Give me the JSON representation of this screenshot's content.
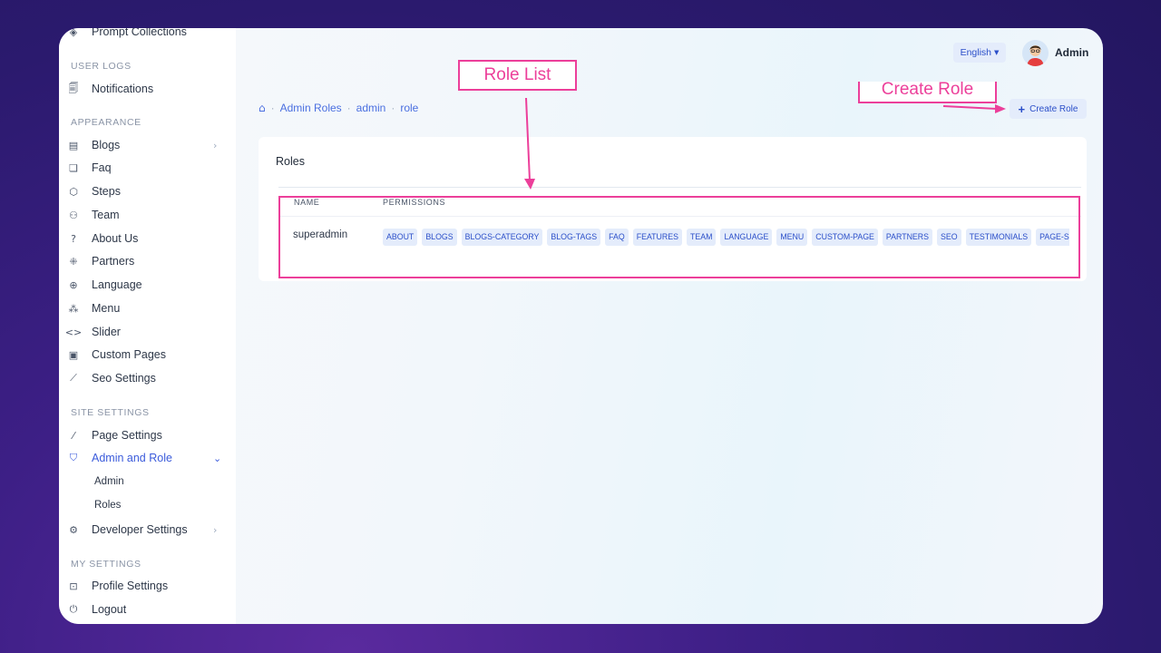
{
  "sidebar": {
    "top_item": "Prompt Collections",
    "sections": [
      {
        "title": "USER LOGS"
      },
      {
        "title": "APPEARANCE"
      },
      {
        "title": "SITE SETTINGS"
      },
      {
        "title": "MY SETTINGS"
      }
    ],
    "items": [
      {
        "label": "Notifications",
        "icon": "bell-icon"
      },
      {
        "label": "Blogs",
        "icon": "blog-icon"
      },
      {
        "label": "Faq",
        "icon": "faq-icon"
      },
      {
        "label": "Steps",
        "icon": "steps-icon"
      },
      {
        "label": "Team",
        "icon": "team-icon"
      },
      {
        "label": "About Us",
        "icon": "help-icon"
      },
      {
        "label": "Partners",
        "icon": "partners-icon"
      },
      {
        "label": "Language",
        "icon": "globe-icon"
      },
      {
        "label": "Menu",
        "icon": "menu-icon"
      },
      {
        "label": "Slider",
        "icon": "code-icon"
      },
      {
        "label": "Custom Pages",
        "icon": "page-icon"
      },
      {
        "label": "Seo Settings",
        "icon": "chart-icon"
      },
      {
        "label": "Page Settings",
        "icon": "magic-wand-icon"
      },
      {
        "label": "Admin and Role",
        "icon": "shield-icon"
      },
      {
        "label": "Developer Settings",
        "icon": "gear-icon"
      },
      {
        "label": "Profile Settings",
        "icon": "profile-icon"
      },
      {
        "label": "Logout",
        "icon": "power-icon"
      }
    ],
    "sub_items": [
      "Admin",
      "Roles"
    ]
  },
  "header": {
    "language": "English",
    "user_name": "Admin"
  },
  "breadcrumb": [
    "Admin Roles",
    "admin",
    "role"
  ],
  "create_button": "Create Role",
  "card": {
    "title": "Roles",
    "columns": [
      "NAME",
      "PERMISSIONS"
    ],
    "rows": [
      {
        "name": "superadmin",
        "permissions": [
          "ABOUT",
          "BLOGS",
          "BLOGS-CATEGORY",
          "BLOG-TAGS",
          "FAQ",
          "FEATURES",
          "TEAM",
          "LANGUAGE",
          "MENU",
          "CUSTOM-PAGE",
          "PARTNERS",
          "SEO",
          "TESTIMONIALS",
          "PAGE-SETTINGS"
        ]
      }
    ]
  },
  "annotations": {
    "role_list": "Role List",
    "create_role": "Create Role",
    "color": "#ec3f9a"
  },
  "colors": {
    "accent": "#3b5bdb",
    "badge_bg": "#e4ecfb",
    "background": "#3d1f86"
  }
}
